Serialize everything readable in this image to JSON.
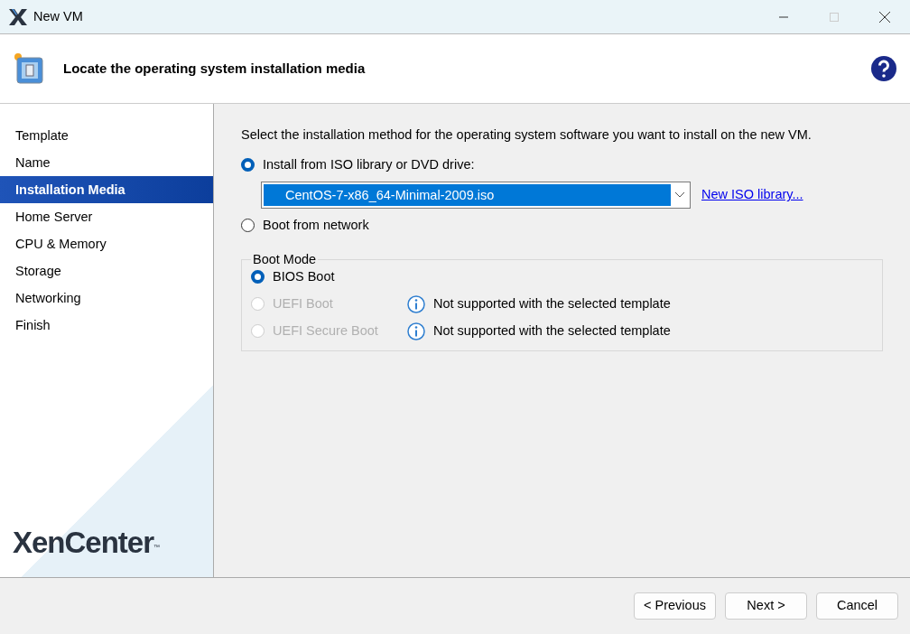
{
  "window": {
    "title": "New VM",
    "maximize_disabled": true
  },
  "header": {
    "title": "Locate the operating system installation media"
  },
  "steps": [
    {
      "label": "Template",
      "selected": false
    },
    {
      "label": "Name",
      "selected": false
    },
    {
      "label": "Installation Media",
      "selected": true
    },
    {
      "label": "Home Server",
      "selected": false
    },
    {
      "label": "CPU & Memory",
      "selected": false
    },
    {
      "label": "Storage",
      "selected": false
    },
    {
      "label": "Networking",
      "selected": false
    },
    {
      "label": "Finish",
      "selected": false
    }
  ],
  "logo": {
    "text": "XenCenter",
    "mark": "™"
  },
  "instruction": "Select the installation method for the operating system software you want to install on the new VM.",
  "install_options": [
    {
      "label": "Install from ISO library or DVD drive:",
      "selected": true,
      "dropdown": {
        "value": "CentOS-7-x86_64-Minimal-2009.iso"
      },
      "link": "New ISO library..."
    },
    {
      "label": "Boot from network",
      "selected": false
    }
  ],
  "boot_mode": {
    "title": "Boot Mode",
    "options": [
      {
        "label": "BIOS Boot",
        "selected": true,
        "disabled": false
      },
      {
        "label": "UEFI Boot",
        "selected": false,
        "disabled": true,
        "note": "Not supported with the selected template"
      },
      {
        "label": "UEFI Secure Boot",
        "selected": false,
        "disabled": true,
        "note": "Not supported with the selected template"
      }
    ]
  },
  "buttons": [
    "< Previous",
    "Next >",
    "Cancel"
  ]
}
